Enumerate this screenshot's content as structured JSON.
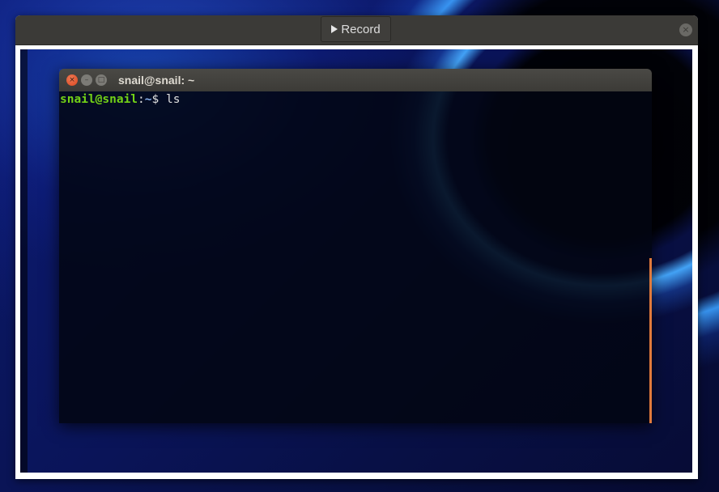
{
  "recorder": {
    "record_label": "Record",
    "close_symbol": "×"
  },
  "terminal": {
    "title": "snail@snail: ~",
    "prompt_user": "snail@snail",
    "prompt_sep": ":",
    "prompt_path": "~",
    "prompt_symbol": "$ ",
    "command": "ls",
    "buttons": {
      "close": "×",
      "minimize": "–",
      "maximize": "□"
    }
  },
  "colors": {
    "prompt_user": "#73d216",
    "prompt_path": "#8ab4f0",
    "scrollbar": "#e07a3c",
    "close_button": "#d9461f"
  }
}
